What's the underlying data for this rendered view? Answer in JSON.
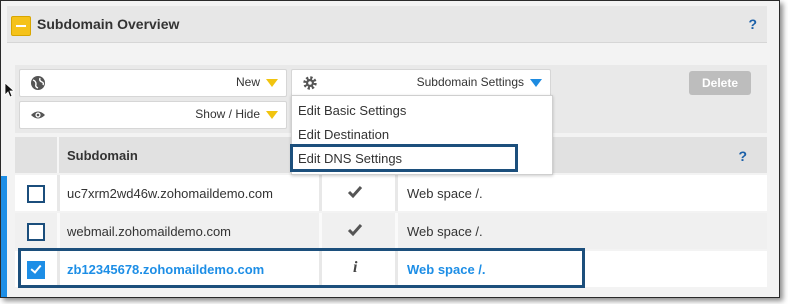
{
  "panel": {
    "title": "Subdomain Overview",
    "help": "?"
  },
  "toolbar": {
    "new_label": "New",
    "show_hide_label": "Show / Hide",
    "settings_label": "Subdomain Settings",
    "delete_label": "Delete"
  },
  "settings_menu": {
    "items": [
      "Edit Basic Settings",
      "Edit Destination",
      "Edit DNS Settings"
    ]
  },
  "table": {
    "column_subdomain": "Subdomain",
    "help": "?",
    "rows": [
      {
        "checked": false,
        "subdomain": "uc7xrm2wd46w.zohomaildemo.com",
        "status_icon": "check-icon",
        "target": "Web space /."
      },
      {
        "checked": false,
        "subdomain": "webmail.zohomaildemo.com",
        "status_icon": "check-icon",
        "target": "Web space /."
      },
      {
        "checked": true,
        "subdomain": "zb12345678.zohomaildemo.com",
        "status_icon": "info-icon",
        "target": "Web space /."
      }
    ]
  },
  "colors": {
    "accent": "#1d8ee6",
    "highlight": "#1c4f7c",
    "collapse": "#f5c21a"
  }
}
